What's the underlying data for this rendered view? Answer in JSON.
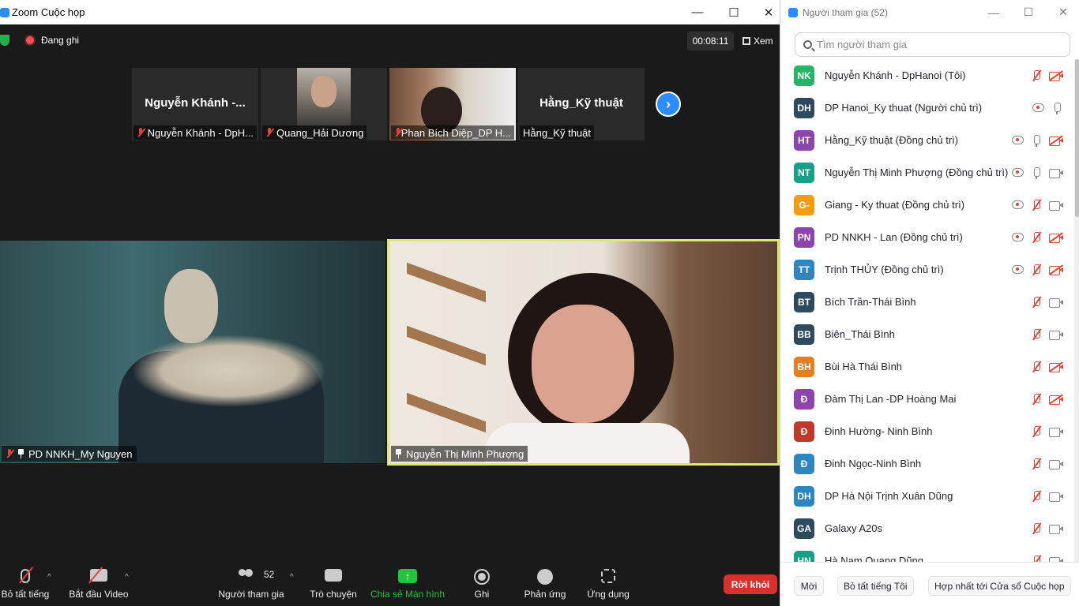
{
  "meeting_window": {
    "title": "Zoom Cuộc họp",
    "recording_label": "Đang ghi",
    "timer": "00:08:11",
    "view_label": "Xem",
    "thumbnails": [
      {
        "big_name": "Nguyễn Khánh -...",
        "caption": "Nguyễn Khánh - DpH..."
      },
      {
        "big_name": "",
        "caption": "Quang_Hải Dương"
      },
      {
        "big_name": "",
        "caption": "Phan Bích Diệp_DP H..."
      },
      {
        "big_name": "Hằng_Kỹ thuật",
        "caption": "Hằng_Kỹ thuật"
      }
    ],
    "main_videos": [
      {
        "caption": "PD NNKH_My Nguyen"
      },
      {
        "caption": "Nguyễn Thị Minh Phượng"
      }
    ],
    "toolbar": {
      "mute_all": "Bỏ tất tiếng",
      "start_video": "Bắt đầu Video",
      "participants": "Người tham gia",
      "participants_count": "52",
      "chat": "Trò chuyện",
      "share_screen": "Chia sẻ Màn hình",
      "record": "Ghi",
      "reactions": "Phản ứng",
      "apps": "Ứng dụng",
      "leave": "Rời khỏi"
    },
    "colors": {
      "share_green": "#1fc53c",
      "leave_red": "#d8312b",
      "active_speaker_border": "#dbea6d"
    }
  },
  "participants_panel": {
    "title": "Người tham gia (52)",
    "search_placeholder": "Tìm người tham gia",
    "participants": [
      {
        "initials": "NK",
        "color": "#26b469",
        "name": "Nguyễn Khánh - DpHanoi (Tôi)",
        "cloud": false,
        "mic": "off",
        "cam": "off"
      },
      {
        "initials": "DH",
        "color": "#2d4a5e",
        "name": "DP Hanoi_Ky thuat (Người chủ trì)",
        "cloud": true,
        "mic": "on",
        "cam": "none"
      },
      {
        "initials": "HT",
        "color": "#8e44ad",
        "name": "Hằng_Kỹ thuật (Đồng chủ trì)",
        "cloud": true,
        "mic": "on",
        "cam": "off"
      },
      {
        "initials": "NT",
        "color": "#16a085",
        "name": "Nguyễn Thị Minh Phượng (Đồng chủ trì)",
        "cloud": true,
        "mic": "on",
        "cam": "on"
      },
      {
        "initials": "G-",
        "color": "#f39c12",
        "name": "Giang - Ky thuat (Đồng chủ trì)",
        "cloud": true,
        "mic": "off",
        "cam": "on"
      },
      {
        "initials": "PN",
        "color": "#8e44ad",
        "name": "PD NNKH - Lan (Đồng chủ trì)",
        "cloud": true,
        "mic": "off",
        "cam": "off"
      },
      {
        "initials": "TT",
        "color": "#2e86c1",
        "name": "Trịnh THỦY (Đồng chủ trì)",
        "cloud": true,
        "mic": "off",
        "cam": "off"
      },
      {
        "initials": "BT",
        "color": "#2d4a5e",
        "name": "Bích Trần-Thái Bình",
        "cloud": false,
        "mic": "off",
        "cam": "on"
      },
      {
        "initials": "BB",
        "color": "#2d4a5e",
        "name": "Biên_Thái Bình",
        "cloud": false,
        "mic": "off",
        "cam": "on"
      },
      {
        "initials": "BH",
        "color": "#e67e22",
        "name": "Bùi Hà Thái Bình",
        "cloud": false,
        "mic": "off",
        "cam": "off"
      },
      {
        "initials": "Đ",
        "color": "#8e44ad",
        "name": "Đàm Thị Lan -DP Hoàng Mai",
        "cloud": false,
        "mic": "off",
        "cam": "off"
      },
      {
        "initials": "Đ",
        "color": "#c0392b",
        "name": "Đinh Hường- Ninh Bình",
        "cloud": false,
        "mic": "off",
        "cam": "on"
      },
      {
        "initials": "Đ",
        "color": "#2e86c1",
        "name": "Đinh Ngọc-Ninh Bình",
        "cloud": false,
        "mic": "off",
        "cam": "on"
      },
      {
        "initials": "DH",
        "color": "#2e86c1",
        "name": "DP Hà Nội Trịnh Xuân Dũng",
        "cloud": false,
        "mic": "off",
        "cam": "on"
      },
      {
        "initials": "GA",
        "color": "#2d4a5e",
        "name": "Galaxy A20s",
        "cloud": false,
        "mic": "off",
        "cam": "on"
      },
      {
        "initials": "HN",
        "color": "#16a085",
        "name": "Hà Nam Quang Dũng",
        "cloud": false,
        "mic": "off",
        "cam": "on"
      }
    ],
    "footer": {
      "invite": "Mời",
      "mute_all": "Bỏ tất tiếng Tôi",
      "merge": "Hợp nhất tới Cửa sổ Cuộc họp"
    }
  }
}
